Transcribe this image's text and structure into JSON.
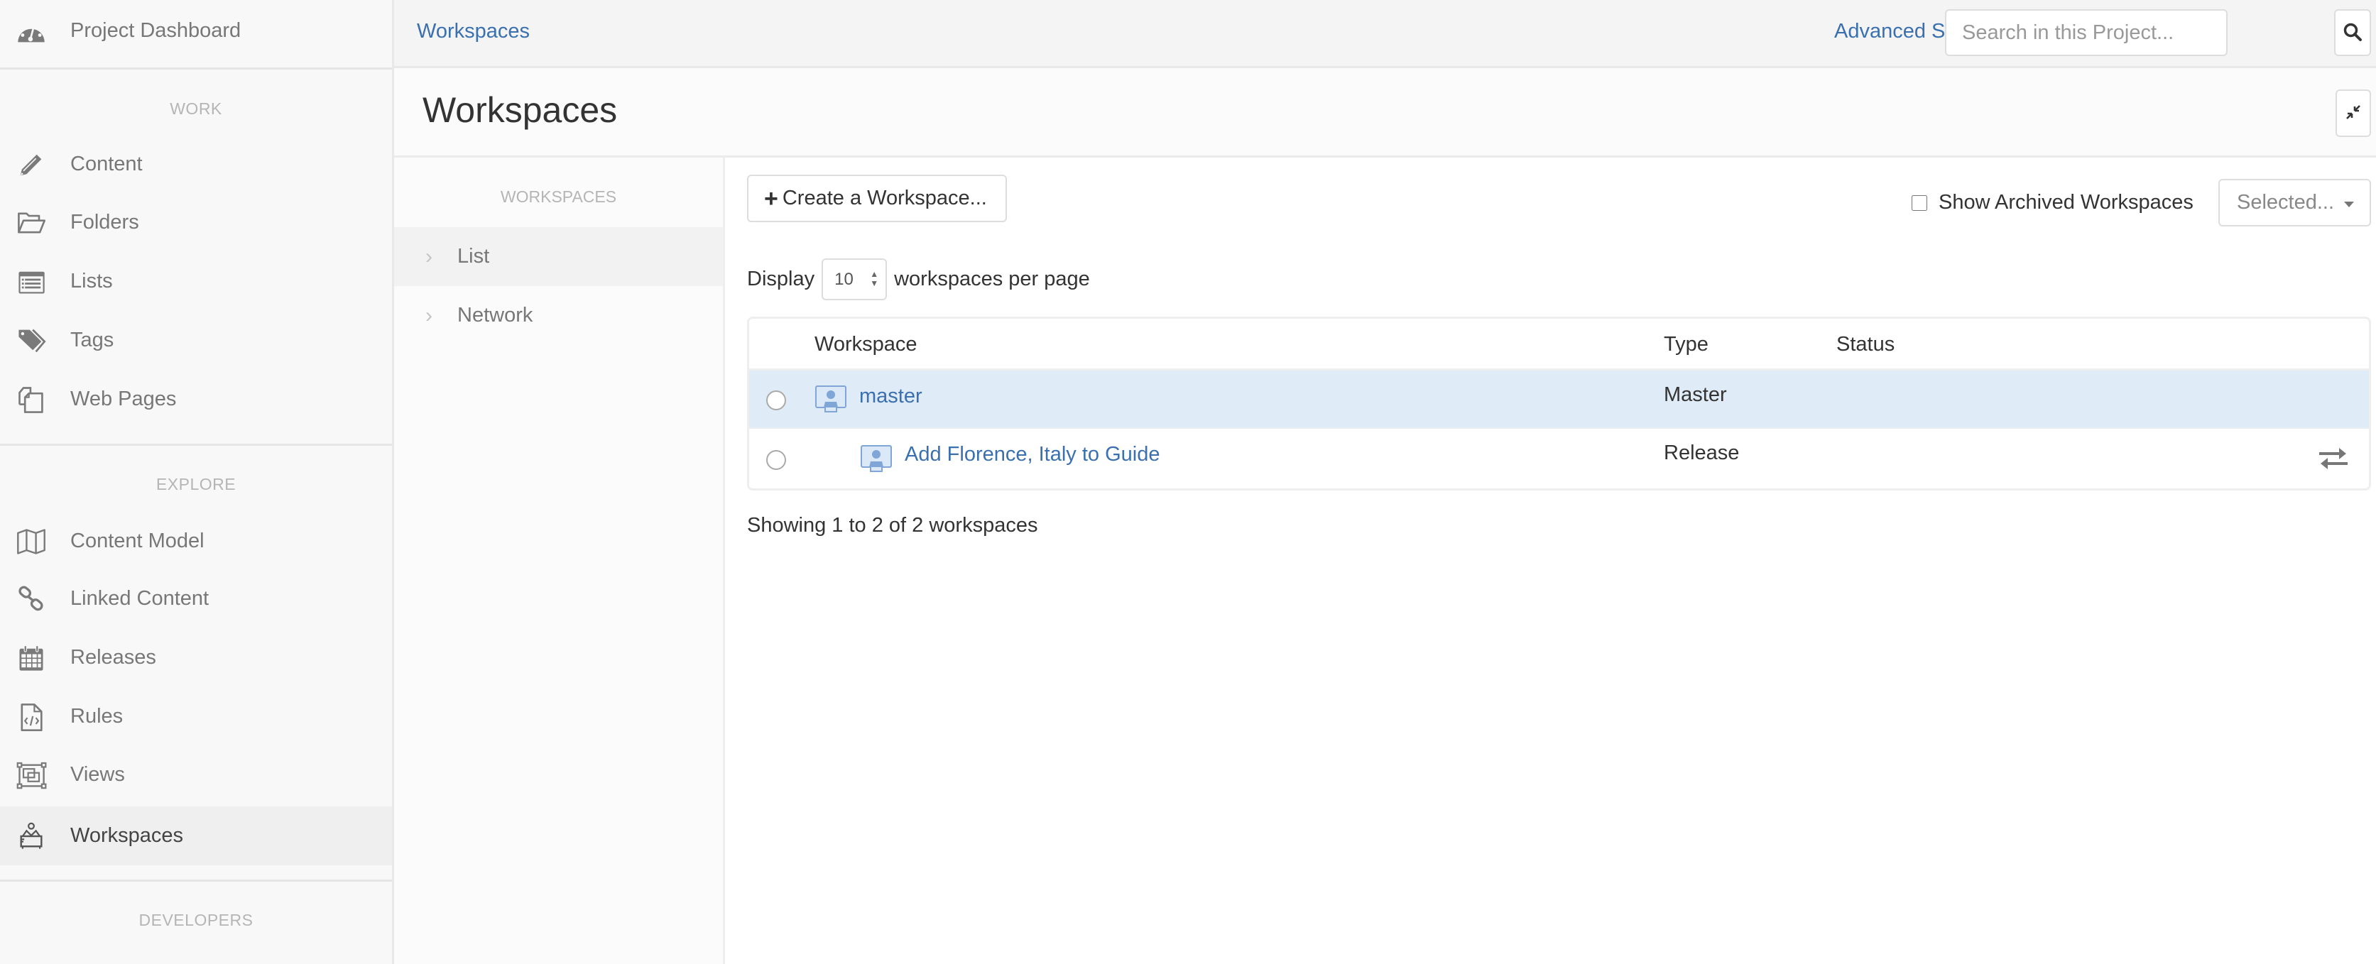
{
  "sidebar": {
    "dashboard": {
      "label": "Project Dashboard",
      "icon": "dashboard-icon"
    },
    "sections": [
      {
        "title": "WORK",
        "items": [
          {
            "label": "Content",
            "icon": "pencil-icon"
          },
          {
            "label": "Folders",
            "icon": "folder-open-icon"
          },
          {
            "label": "Lists",
            "icon": "list-icon"
          },
          {
            "label": "Tags",
            "icon": "tags-icon"
          },
          {
            "label": "Web Pages",
            "icon": "web-pages-icon"
          }
        ]
      },
      {
        "title": "EXPLORE",
        "items": [
          {
            "label": "Content Model",
            "icon": "map-icon"
          },
          {
            "label": "Linked Content",
            "icon": "link-icon"
          },
          {
            "label": "Releases",
            "icon": "calendar-icon"
          },
          {
            "label": "Rules",
            "icon": "code-file-icon"
          },
          {
            "label": "Views",
            "icon": "views-icon"
          },
          {
            "label": "Workspaces",
            "icon": "workspace-icon",
            "active": true
          }
        ]
      },
      {
        "title": "DEVELOPERS",
        "items": []
      }
    ]
  },
  "header": {
    "breadcrumb": "Workspaces",
    "advanced_search": "Advanced Search",
    "search_placeholder": "Search in this Project...",
    "search_value": ""
  },
  "page": {
    "title": "Workspaces"
  },
  "subnav": {
    "title": "WORKSPACES",
    "items": [
      {
        "label": "List",
        "active": true
      },
      {
        "label": "Network",
        "active": false
      }
    ]
  },
  "main": {
    "create_button": "Create a Workspace...",
    "show_archived_label": "Show Archived Workspaces",
    "show_archived_checked": false,
    "bulk_action_dropdown": "Selected...",
    "display_prefix": "Display",
    "per_page_value": "10",
    "display_suffix": "workspaces per page",
    "table": {
      "columns": [
        "Workspace",
        "Type",
        "Status"
      ],
      "rows": [
        {
          "name": "master",
          "type": "Master",
          "status": "",
          "selected": false,
          "highlighted": true,
          "indent": 0,
          "action_icon": ""
        },
        {
          "name": "Add Florence, Italy to Guide",
          "type": "Release",
          "status": "",
          "selected": false,
          "highlighted": false,
          "indent": 1,
          "action_icon": "sync-arrows-icon"
        }
      ]
    },
    "footer": "Showing 1 to 2 of 2 workspaces"
  },
  "colors": {
    "link": "#3a70b0",
    "row_highlight": "#dfebf6",
    "sidebar_bg": "#f8f8f8",
    "sidebar_active": "#efefef"
  }
}
